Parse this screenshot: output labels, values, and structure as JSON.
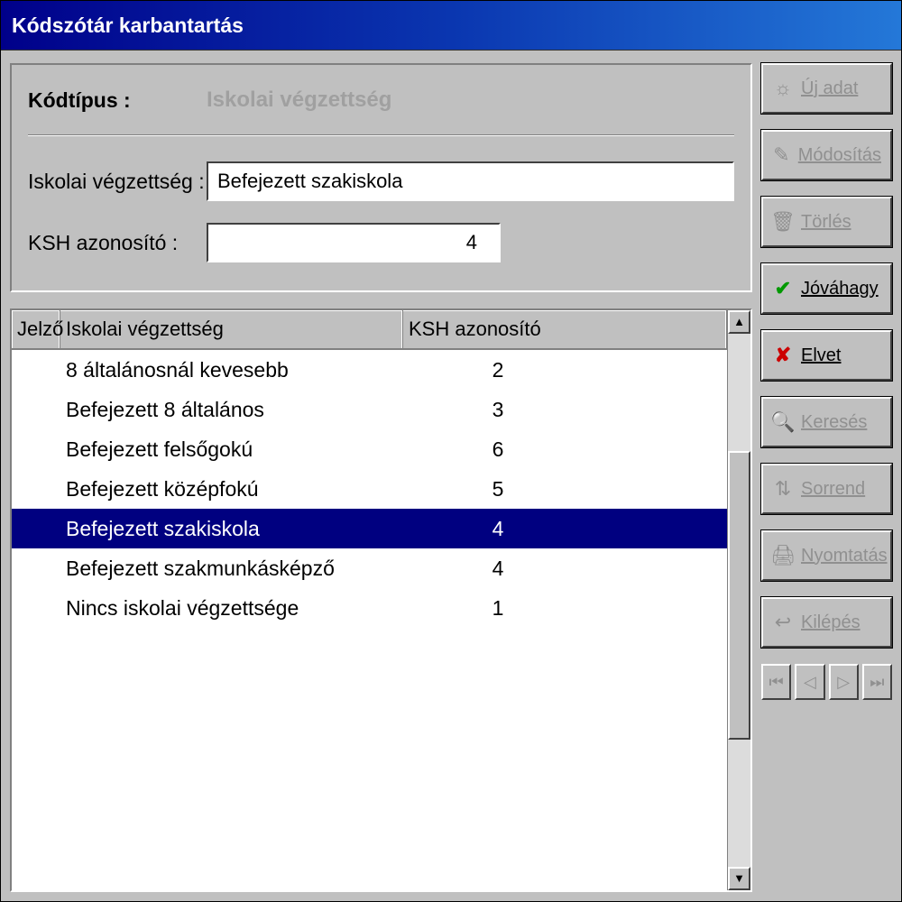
{
  "title": "Kódszótár karbantartás",
  "form": {
    "kodtipus_label": "Kódtípus :",
    "kodtipus_value": "Iskolai végzettség",
    "iskolai_label": "Iskolai végzettség :",
    "iskolai_value": "Befejezett szakiskola",
    "ksh_label": "KSH azonosító :",
    "ksh_value": "4"
  },
  "list": {
    "headers": {
      "jelzo": "Jelző",
      "iskolai": "Iskolai végzettség",
      "ksh": "KSH azonosító"
    },
    "rows": [
      {
        "name": "8 általánosnál kevesebb",
        "ksh": "2",
        "sel": false
      },
      {
        "name": "Befejezett 8 általános",
        "ksh": "3",
        "sel": false
      },
      {
        "name": "Befejezett felsőgokú",
        "ksh": "6",
        "sel": false
      },
      {
        "name": "Befejezett középfokú",
        "ksh": "5",
        "sel": false
      },
      {
        "name": "Befejezett szakiskola",
        "ksh": "4",
        "sel": true
      },
      {
        "name": "Befejezett szakmunkásképző",
        "ksh": "4",
        "sel": false
      },
      {
        "name": "Nincs iskolai végzettsége",
        "ksh": "1",
        "sel": false
      }
    ]
  },
  "buttons": {
    "ujadat": "Új adat",
    "modositas": "Módosítás",
    "torles": "Törlés",
    "jovahagy": "Jóváhagy",
    "elvet": "Elvet",
    "kereses": "Keresés",
    "sorrend": "Sorrend",
    "nyomtatas": "Nyomtatás",
    "kilepes": "Kilépés"
  }
}
